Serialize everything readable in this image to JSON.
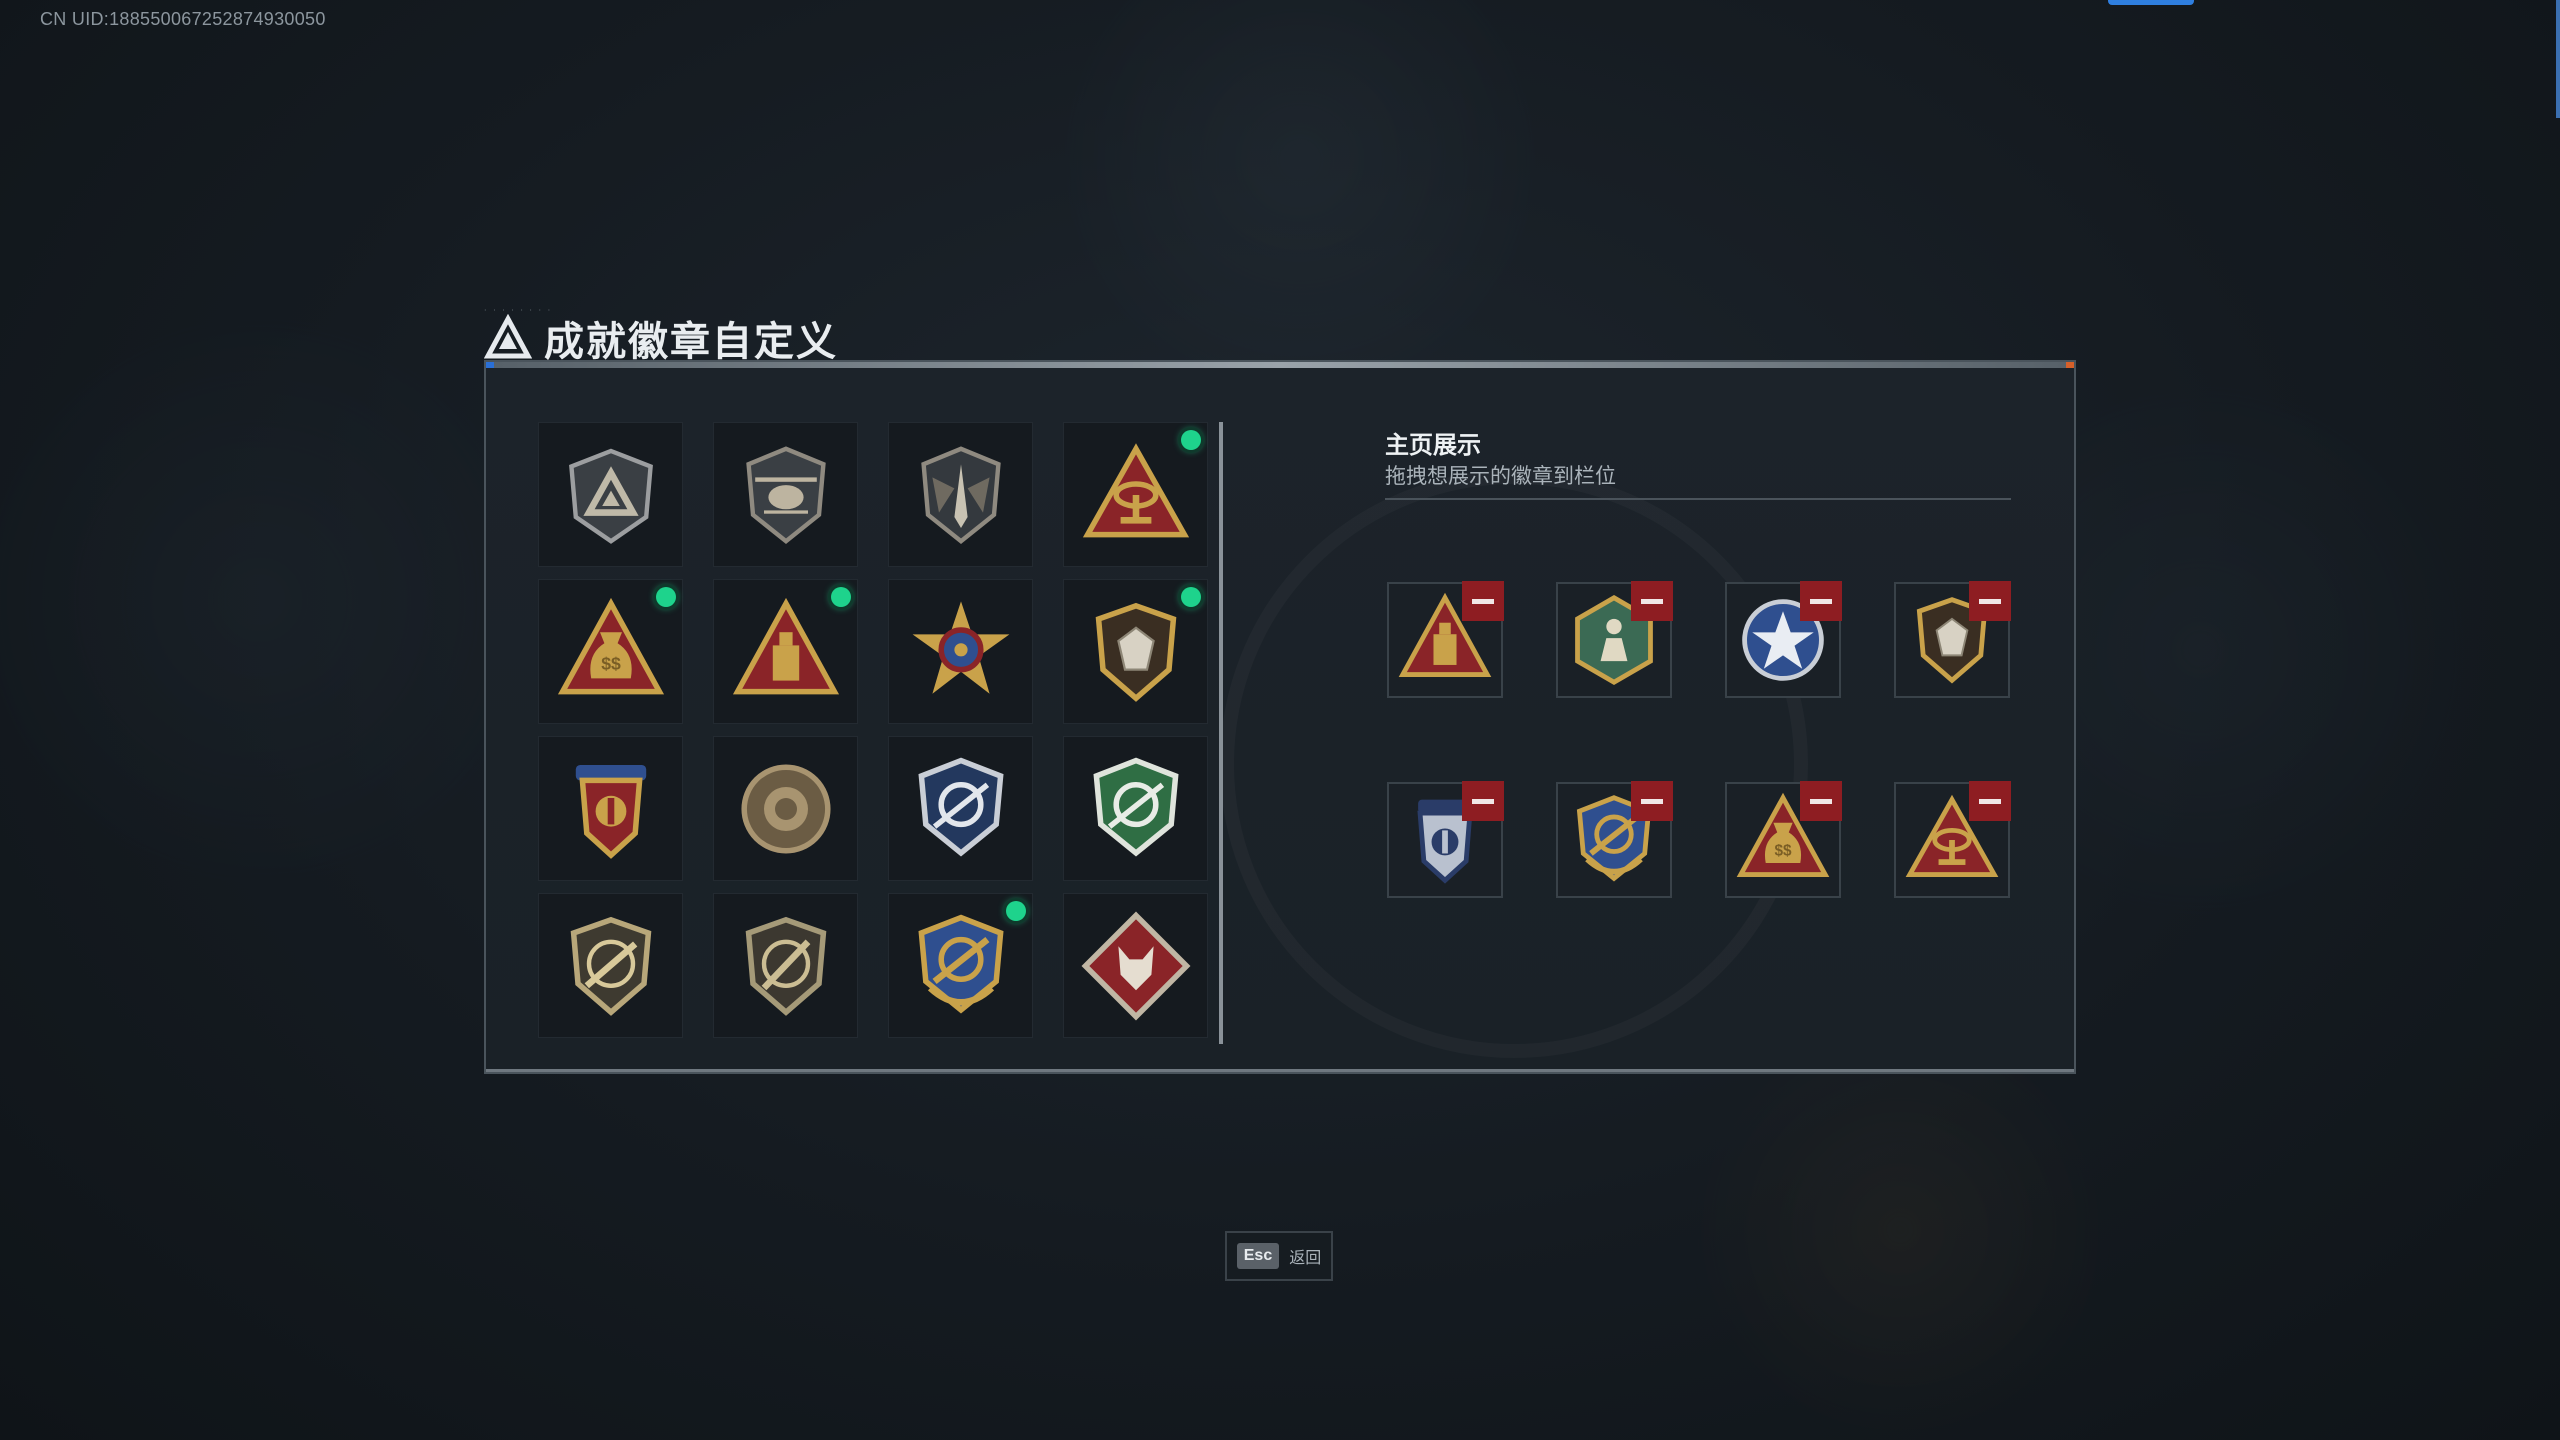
{
  "header": {
    "uid": "CN UID:188550067252874930050",
    "title": "成就徽章自定义"
  },
  "badge_grid": [
    {
      "icon": "shield-triangle-badge-icon",
      "new": false
    },
    {
      "icon": "helicopter-badge-icon",
      "new": false
    },
    {
      "icon": "dagger-shield-badge-icon",
      "new": false
    },
    {
      "icon": "radar-triangle-badge-icon",
      "new": true
    },
    {
      "icon": "money-bag-triangle-badge-icon",
      "new": true
    },
    {
      "icon": "tower-triangle-badge-icon",
      "new": true
    },
    {
      "icon": "star-burst-badge-icon",
      "new": false
    },
    {
      "icon": "gem-shield-badge-icon",
      "new": true
    },
    {
      "icon": "stars-crest-badge-icon",
      "new": false
    },
    {
      "icon": "emblem-round-badge-icon",
      "new": false
    },
    {
      "icon": "blue-crosshair-badge-icon",
      "new": false
    },
    {
      "icon": "green-crosshair-badge-icon",
      "new": false
    },
    {
      "icon": "rifle-shield-badge-icon",
      "new": false
    },
    {
      "icon": "rifle-shield-alt-badge-icon",
      "new": false
    },
    {
      "icon": "gold-crosshair-badge-icon",
      "new": true
    },
    {
      "icon": "wolf-diamond-badge-icon",
      "new": false
    }
  ],
  "display": {
    "title": "主页展示",
    "subtitle": "拖拽想展示的徽章到栏位",
    "slots": [
      {
        "icon": "tower-triangle-badge-icon"
      },
      {
        "icon": "green-hex-figure-badge-icon"
      },
      {
        "icon": "blue-star-badge-icon"
      },
      {
        "icon": "gem-shield-badge-icon"
      },
      {
        "icon": "blue-crest-badge-icon"
      },
      {
        "icon": "gold-crosshair-badge-icon"
      },
      {
        "icon": "money-bag-triangle-badge-icon"
      },
      {
        "icon": "radar-triangle-badge-icon"
      }
    ]
  },
  "footer": {
    "esc_key": "Esc",
    "esc_label": "返回"
  },
  "colors": {
    "accent_green": "#1ed38c",
    "remove_red": "#8e1d22",
    "gold": "#c9a24a",
    "top_pill_blue": "#2f7fe0"
  }
}
